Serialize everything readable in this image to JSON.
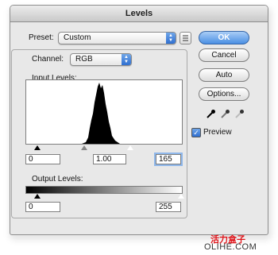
{
  "dialog": {
    "title": "Levels",
    "preset_label": "Preset:",
    "preset_value": "Custom",
    "channel_label": "Channel:",
    "channel_value": "RGB",
    "input_levels_label": "Input Levels:",
    "input_black": "0",
    "input_gamma": "1.00",
    "input_white": "165",
    "output_levels_label": "Output Levels:",
    "output_black": "0",
    "output_white": "255",
    "preview_label": "Preview",
    "preview_checked": true
  },
  "buttons": {
    "ok": "OK",
    "cancel": "Cancel",
    "auto": "Auto",
    "options": "Options..."
  },
  "icons": {
    "preset_options": "list-menu-icon",
    "black_eyedropper": "eyedropper-black-icon",
    "gray_eyedropper": "eyedropper-gray-icon",
    "white_eyedropper": "eyedropper-white-icon"
  },
  "watermark": {
    "line1": "活力盒子",
    "line2": "OLIHE.COM"
  },
  "colors": {
    "accent_blue": "#2f6fd0",
    "watermark_red": "#e0151b"
  }
}
